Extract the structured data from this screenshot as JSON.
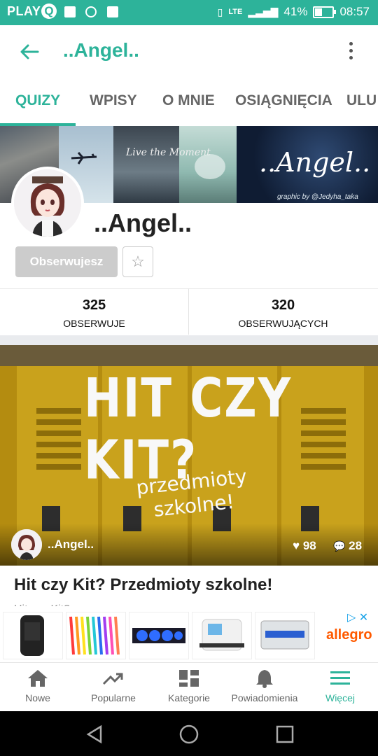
{
  "status_bar": {
    "carrier": "PLAY",
    "carrier_badge": "Q",
    "network": "LTE",
    "battery": "41%",
    "time": "08:57"
  },
  "toolbar": {
    "back_icon": "arrow-back-icon",
    "title": "..Angel..",
    "menu_icon": "more-vert-icon"
  },
  "tabs": [
    {
      "label": "QUIZY",
      "active": true
    },
    {
      "label": "WPISY",
      "active": false
    },
    {
      "label": "O MNIE",
      "active": false
    },
    {
      "label": "OSIĄGNIĘCIA",
      "active": false
    },
    {
      "label": "ULU",
      "active": false
    }
  ],
  "banner": {
    "text": "..Angel..",
    "credit": "graphic by @Jedyha_taka",
    "overlay_text": "Live the Moment"
  },
  "profile": {
    "name": "..Angel..",
    "follow_button": "Obserwujesz",
    "star_icon": "star-outline-icon",
    "stats": [
      {
        "value": "325",
        "label": "OBSERWUJE"
      },
      {
        "value": "320",
        "label": "OBSERWUJĄCYCH"
      }
    ]
  },
  "quiz_card": {
    "image_title": "HIT CZY KIT?",
    "image_subtitle_line1": "przedmioty",
    "image_subtitle_line2": "szkolne!",
    "author": "..Angel..",
    "likes": "98",
    "comments": "28",
    "title": "Hit czy Kit? Przedmioty szkolne!",
    "desc_partial": "Hit czy Kit? ..."
  },
  "ad": {
    "brand": "allegro",
    "items": 5
  },
  "bottom_nav": [
    {
      "label": "Nowe",
      "icon": "home-icon",
      "active": false
    },
    {
      "label": "Popularne",
      "icon": "trending-icon",
      "active": false
    },
    {
      "label": "Kategorie",
      "icon": "dashboard-icon",
      "active": false
    },
    {
      "label": "Powiadomienia",
      "icon": "bell-icon",
      "active": false
    },
    {
      "label": "Więcej",
      "icon": "menu-icon",
      "active": true
    }
  ],
  "colors": {
    "accent": "#2db39a",
    "status_bar": "#2db39a",
    "locker": "#c9a21c"
  }
}
